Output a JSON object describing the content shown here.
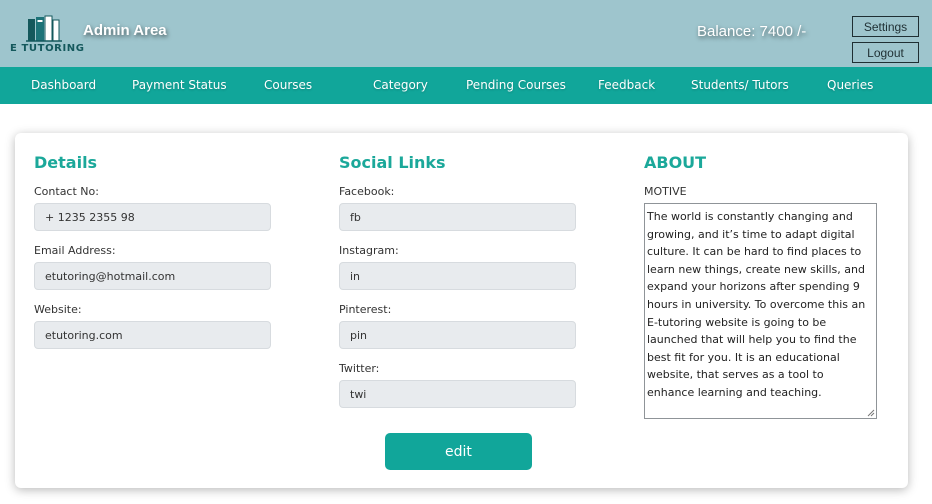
{
  "header": {
    "logo_text": "E TUTORING",
    "title": "Admin Area",
    "balance": "Balance: 7400 /-",
    "settings_label": "Settings",
    "logout_label": "Logout"
  },
  "nav": {
    "items": [
      {
        "label": "Dashboard"
      },
      {
        "label": "Payment Status"
      },
      {
        "label": "Courses"
      },
      {
        "label": "Category"
      },
      {
        "label": "Pending Courses"
      },
      {
        "label": "Feedback"
      },
      {
        "label": "Students/ Tutors"
      },
      {
        "label": "Queries"
      }
    ]
  },
  "details": {
    "heading": "Details",
    "contact_label": "Contact No:",
    "contact_value": "+ 1235 2355 98",
    "email_label": "Email Address:",
    "email_value": "etutoring@hotmail.com",
    "website_label": "Website:",
    "website_value": "etutoring.com"
  },
  "social": {
    "heading": "Social Links",
    "facebook_label": "Facebook:",
    "facebook_value": "fb",
    "instagram_label": "Instagram:",
    "instagram_value": "in",
    "pinterest_label": "Pinterest:",
    "pinterest_value": "pin",
    "twitter_label": "Twitter:",
    "twitter_value": "twi"
  },
  "about": {
    "heading": "ABOUT",
    "motive_label": "MOTIVE",
    "motive_text": "The world is constantly changing and growing, and it’s time to adapt digital culture. It can be hard to find places to learn new things, create new skills, and expand your horizons after spending 9 hours in university. To overcome this an E-tutoring website is going to be launched that will help you to find the best fit for you. It is an educational website, that serves as a tool to enhance learning and teaching."
  },
  "actions": {
    "edit_label": "edit"
  },
  "colors": {
    "header_bg": "#9ec5cd",
    "accent": "#11a69a",
    "heading": "#1ba89a"
  },
  "icons": {
    "logo": "books-icon"
  }
}
